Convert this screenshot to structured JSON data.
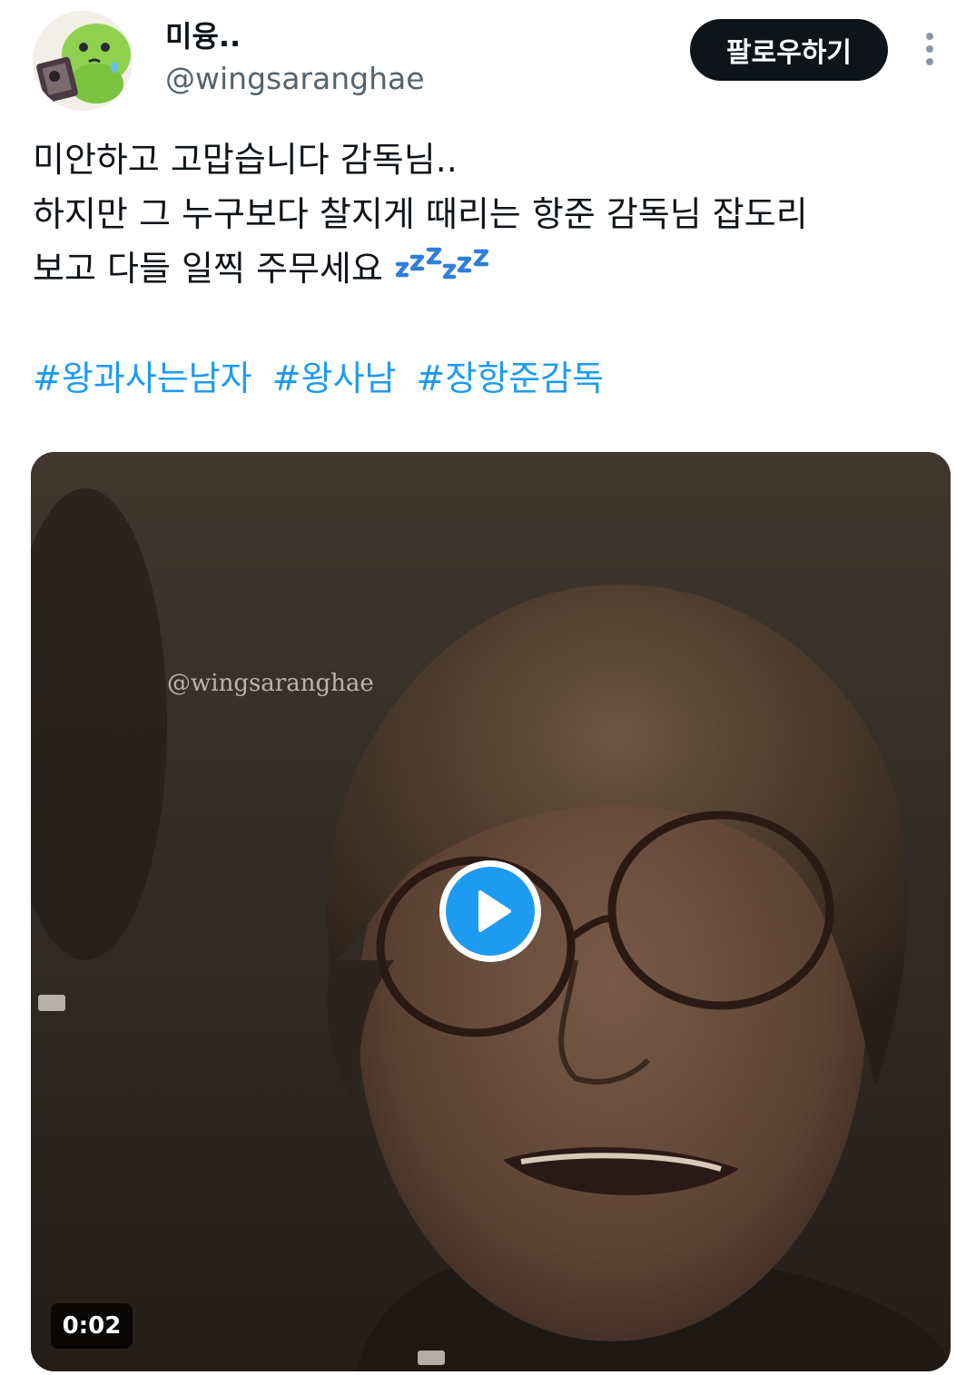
{
  "author": {
    "display_name": "미융..",
    "handle": "@wingsaranghae",
    "avatar_icon": "avatar-character-icon"
  },
  "actions": {
    "follow_label": "팔로우하기",
    "more_icon": "more-options-icon"
  },
  "tweet": {
    "lines": [
      "미안하고 고맙습니다 감독님..",
      "하지만 그 누구보다 찰지게 때리는 항준 감독님 잡도리",
      "보고 다들 일찍 주무세요"
    ],
    "emoji": "zzz-icon",
    "hashtags": [
      "#왕과사는남자",
      "#왕사남",
      "#장항준감독"
    ]
  },
  "media": {
    "watermark": "@wingsaranghae",
    "duration": "0:02",
    "play_icon": "play-icon"
  },
  "colors": {
    "link": "#1d9bf0",
    "text": "#0f1419",
    "secondary": "#536471",
    "button_bg": "#0f1419"
  }
}
